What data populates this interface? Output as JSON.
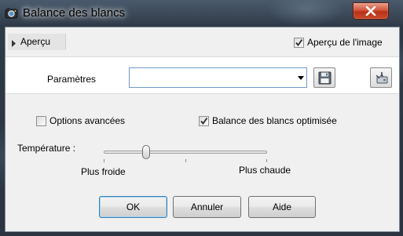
{
  "window": {
    "title": "Balance des blancs",
    "close_label": "close"
  },
  "preview": {
    "tab_label": "Aperçu",
    "image_preview_label": "Aperçu de l'image",
    "image_preview_checked": true
  },
  "params": {
    "label": "Paramètres",
    "value": ""
  },
  "options": {
    "advanced_label": "Options avancées",
    "advanced_checked": false,
    "optimized_label": "Balance des blancs optimisée",
    "optimized_checked": true
  },
  "temperature": {
    "label": "Température :",
    "min_label": "Plus froide",
    "max_label": "Plus chaude",
    "value_fraction": 0.26
  },
  "buttons": {
    "ok": "OK",
    "cancel": "Annuler",
    "help": "Aide"
  },
  "icons": {
    "app": "photo-app-icon",
    "close": "close-icon",
    "expand": "triangle-right-icon",
    "dropdown": "chevron-down-icon",
    "save": "floppy-disk-icon",
    "import": "import-preset-icon"
  },
  "colors": {
    "close_button": "#c94a2a",
    "focus_border": "#3c7fb1",
    "client_bg": "#f0f0f0"
  }
}
